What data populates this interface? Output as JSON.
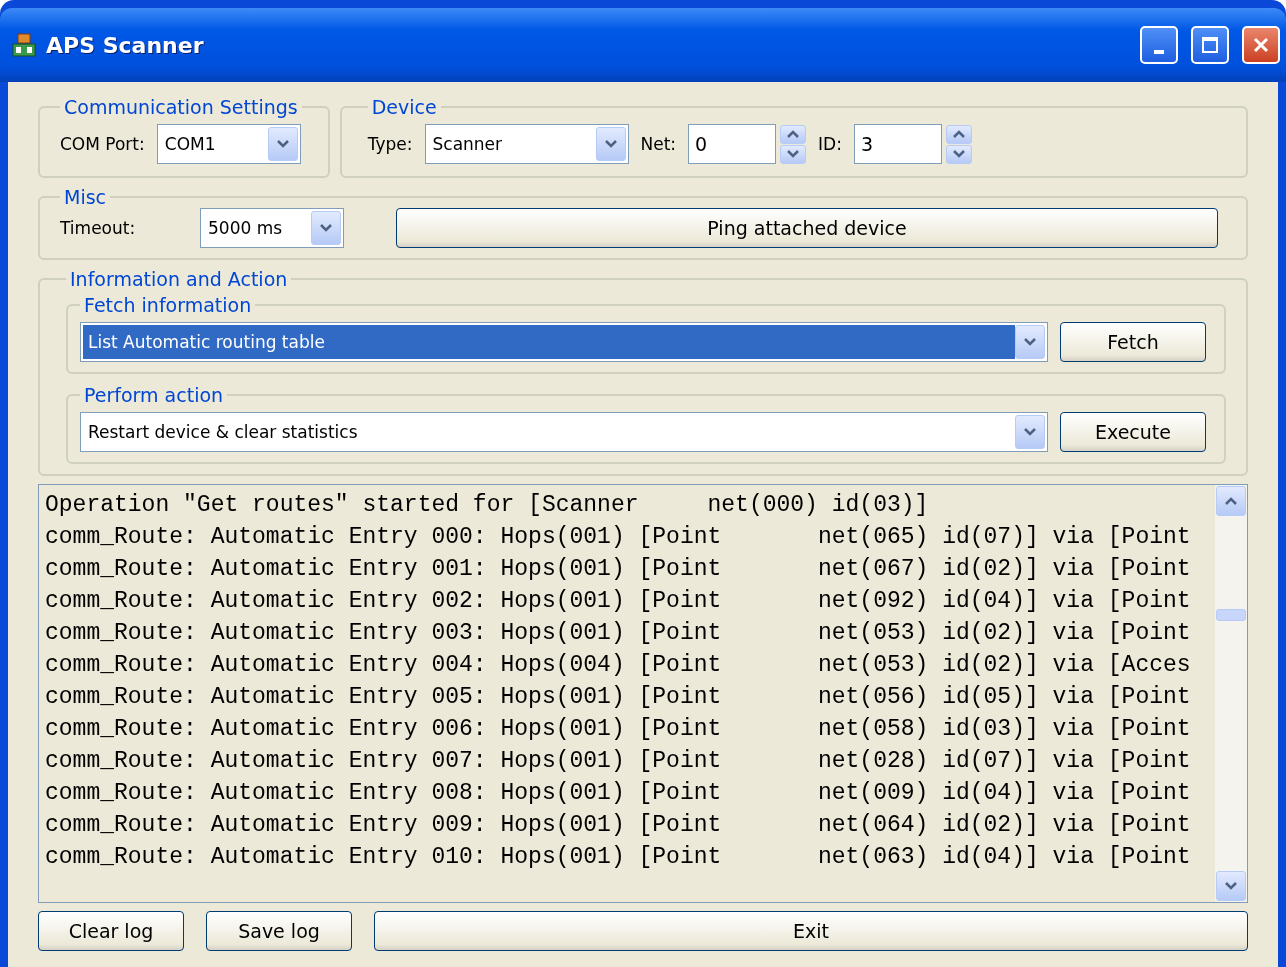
{
  "window": {
    "title": "APS Scanner"
  },
  "communication_settings": {
    "title": "Communication Settings",
    "com_port": {
      "label": "COM Port:",
      "value": "COM1"
    }
  },
  "device": {
    "title": "Device",
    "type": {
      "label": "Type:",
      "value": "Scanner"
    },
    "net": {
      "label": "Net:",
      "value": "0"
    },
    "id": {
      "label": "ID:",
      "value": "3"
    }
  },
  "misc": {
    "title": "Misc",
    "timeout": {
      "label": "Timeout:",
      "value": "5000 ms"
    },
    "ping_button": "Ping attached device"
  },
  "information_and_action": {
    "title": "Information and Action",
    "fetch": {
      "title": "Fetch information",
      "value": "List Automatic routing table",
      "selected": true,
      "button": "Fetch"
    },
    "perform": {
      "title": "Perform action",
      "value": "Restart device & clear statistics",
      "selected": false,
      "button": "Execute"
    }
  },
  "log": {
    "lines": [
      "Operation \"Get routes\" started for [Scanner     net(000) id(03)]",
      "comm_Route: Automatic Entry 000: Hops(001) [Point       net(065) id(07)] via [Point",
      "comm_Route: Automatic Entry 001: Hops(001) [Point       net(067) id(02)] via [Point",
      "comm_Route: Automatic Entry 002: Hops(001) [Point       net(092) id(04)] via [Point",
      "comm_Route: Automatic Entry 003: Hops(001) [Point       net(053) id(02)] via [Point",
      "comm_Route: Automatic Entry 004: Hops(004) [Point       net(053) id(02)] via [Acces",
      "comm_Route: Automatic Entry 005: Hops(001) [Point       net(056) id(05)] via [Point",
      "comm_Route: Automatic Entry 006: Hops(001) [Point       net(058) id(03)] via [Point",
      "comm_Route: Automatic Entry 007: Hops(001) [Point       net(028) id(07)] via [Point",
      "comm_Route: Automatic Entry 008: Hops(001) [Point       net(009) id(04)] via [Point",
      "comm_Route: Automatic Entry 009: Hops(001) [Point       net(064) id(02)] via [Point",
      "comm_Route: Automatic Entry 010: Hops(001) [Point       net(063) id(04)] via [Point"
    ]
  },
  "buttons": [
    {
      "label": "Clear log",
      "kind": "small"
    },
    {
      "label": "Save log",
      "kind": "small"
    },
    {
      "label": "Exit",
      "kind": "wide"
    }
  ]
}
